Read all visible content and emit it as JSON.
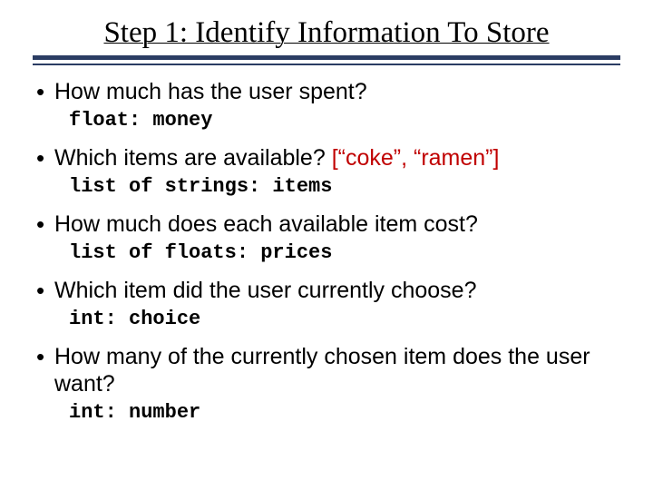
{
  "title": "Step 1: Identify Information To Store",
  "bullets": [
    {
      "q": "How much has the user spent?",
      "extra": "",
      "code": "float: money"
    },
    {
      "q": "Which items are available? ",
      "extra": "[“coke”, “ramen”]",
      "code": "list of strings: items"
    },
    {
      "q": "How much does each available item cost?",
      "extra": "",
      "code": "list of floats: prices"
    },
    {
      "q": "Which item did the user currently choose?",
      "extra": "",
      "code": "int: choice"
    },
    {
      "q": "How many of the currently chosen item does the user want?",
      "extra": "",
      "code": "int: number"
    }
  ]
}
